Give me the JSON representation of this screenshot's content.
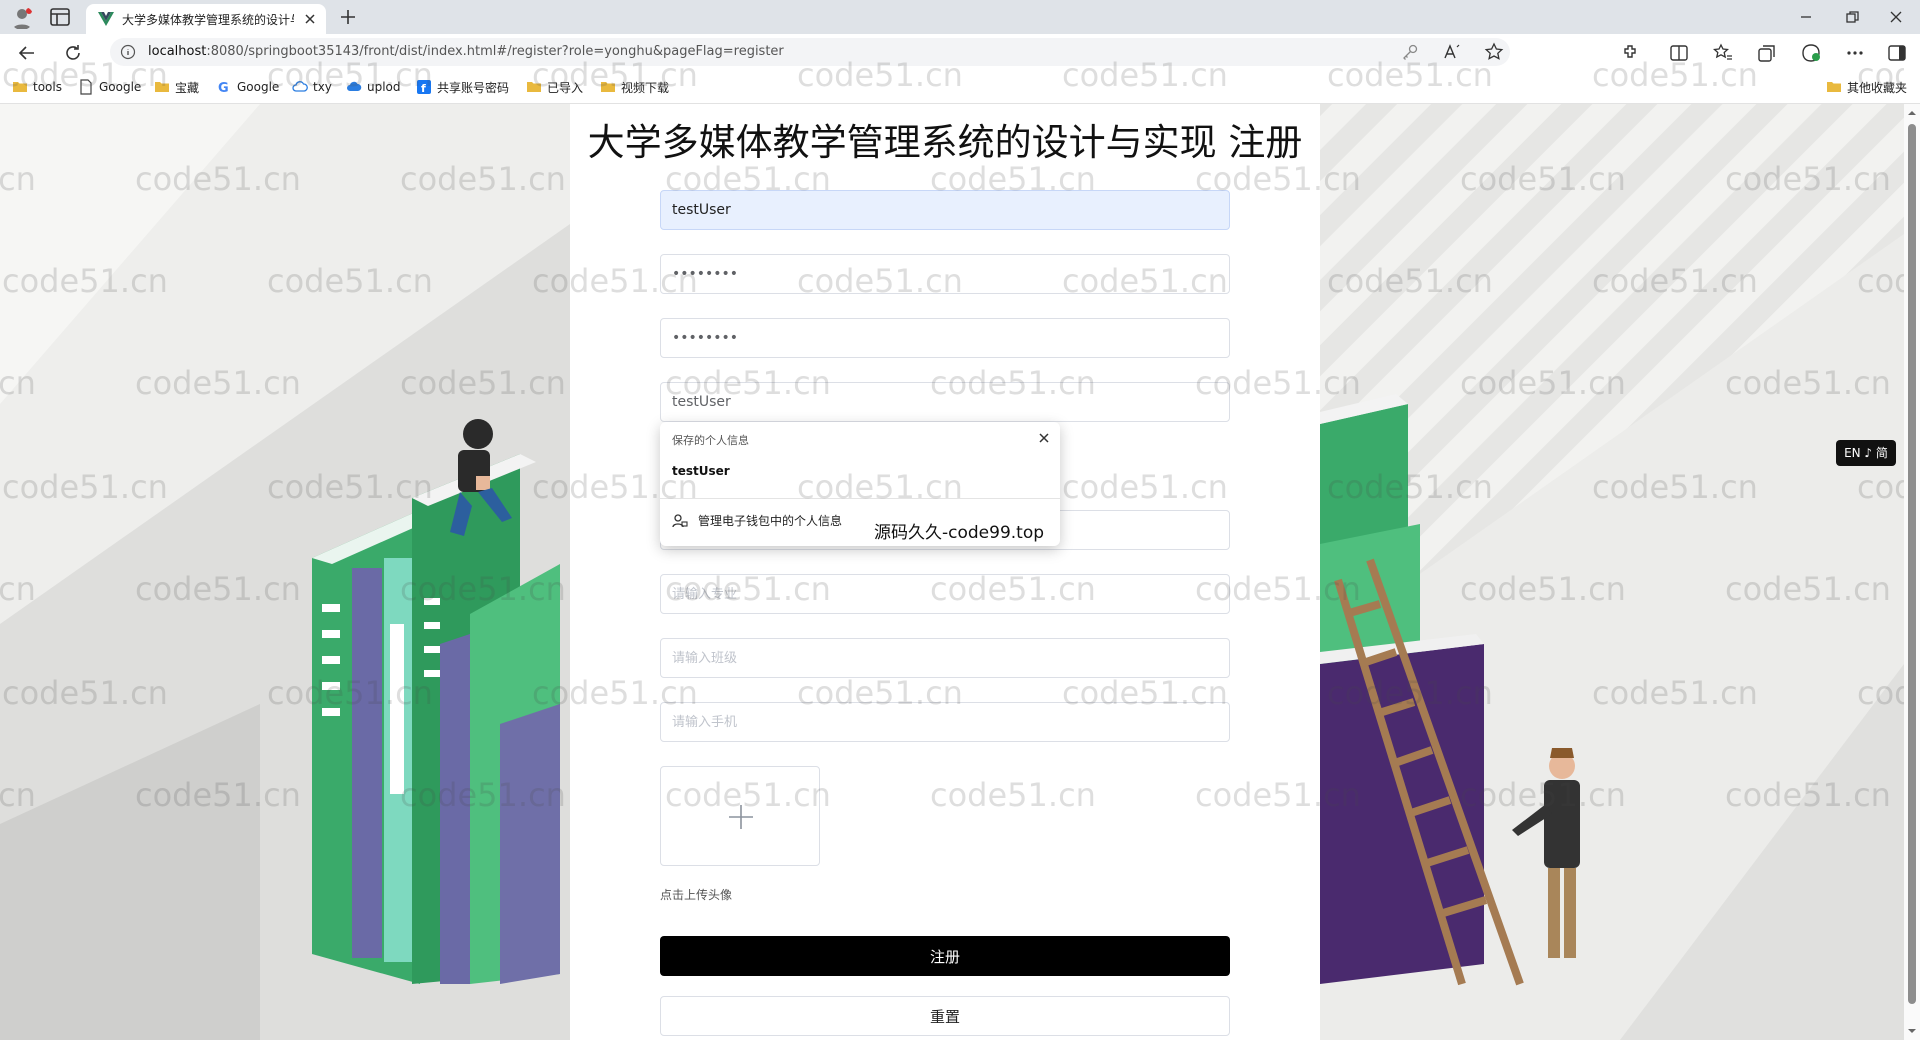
{
  "browser": {
    "tab_title": "大学多媒体教学管理系统的设计与",
    "url_host": "localhost",
    "url_rest": ":8080/springboot35143/front/dist/index.html#/register?role=yonghu&pageFlag=register"
  },
  "bookmarks": {
    "items": [
      {
        "label": "tools",
        "icon": "folder-icon"
      },
      {
        "label": "Google",
        "icon": "page-icon"
      },
      {
        "label": "宝藏",
        "icon": "folder-icon"
      },
      {
        "label": "Google",
        "icon": "google-icon"
      },
      {
        "label": "txy",
        "icon": "cloud-icon"
      },
      {
        "label": "uplod",
        "icon": "cloud-icon"
      },
      {
        "label": "共享账号密码",
        "icon": "facebook-icon"
      },
      {
        "label": "已导入",
        "icon": "folder-icon"
      },
      {
        "label": "视频下载",
        "icon": "folder-icon"
      }
    ],
    "other": "其他收藏夹"
  },
  "page": {
    "title": "大学多媒体教学管理系统的设计与实现 注册"
  },
  "form": {
    "account_value": "testUser",
    "password_value": "••••••••",
    "confirm_value": "••••••••",
    "name_value": "testUser",
    "field5_placeholder": "",
    "major_placeholder": "请输入专业",
    "class_placeholder": "请输入班级",
    "phone_placeholder": "请输入手机",
    "upload_tip": "点击上传头像",
    "register_label": "注册",
    "reset_label": "重置"
  },
  "autofill": {
    "header": "保存的个人信息",
    "item": "testUser",
    "manage": "管理电子钱包中的个人信息"
  },
  "overlay_caption": "源码久久-code99.top",
  "lang_switch": "EN ♪ 简",
  "watermark": "code51.cn",
  "colors": {
    "register_button": "#000000",
    "autofill_bg": "#e8f0fe",
    "green_book": "#3aaa6a",
    "purple_book": "#4a2a6e"
  }
}
